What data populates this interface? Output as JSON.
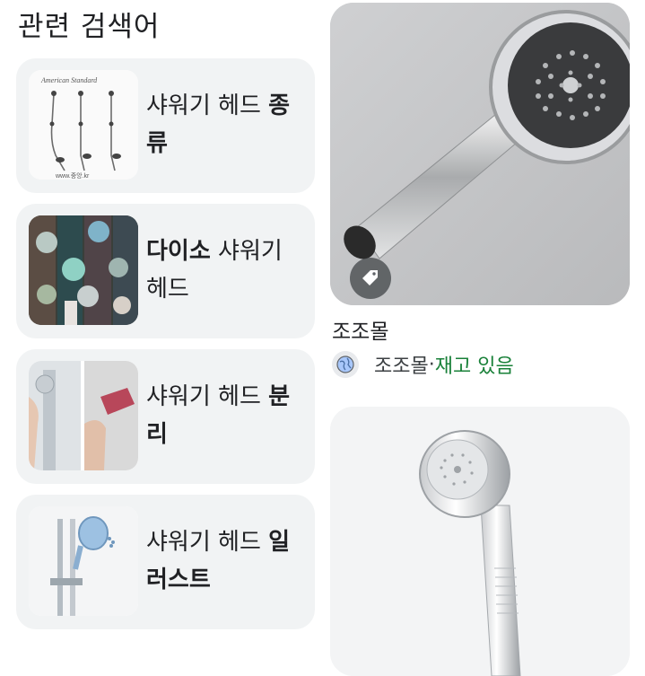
{
  "section": {
    "title": "관련 검색어"
  },
  "related": [
    {
      "plain": "샤워기 헤드 ",
      "bold": "종류",
      "bold_first": false
    },
    {
      "plain": " 샤워기 헤드",
      "bold": "다이소",
      "bold_first": true
    },
    {
      "plain": "샤워기 헤드 ",
      "bold": "분리",
      "bold_first": false
    },
    {
      "plain": "샤워기 헤드 ",
      "bold": "일러스트",
      "bold_first": false
    }
  ],
  "thumb_texts": {
    "brand": "American Standard",
    "url": "www.중앙.kr"
  },
  "results": [
    {
      "source": "조조몰",
      "site": "조조몰",
      "separator": " · ",
      "availability": "재고 있음",
      "tag_icon": "tag-icon"
    },
    {
      "image": "shower-head-chrome"
    }
  ],
  "colors": {
    "card_bg": "#f1f3f4",
    "in_stock": "#188038",
    "text": "#202124"
  }
}
